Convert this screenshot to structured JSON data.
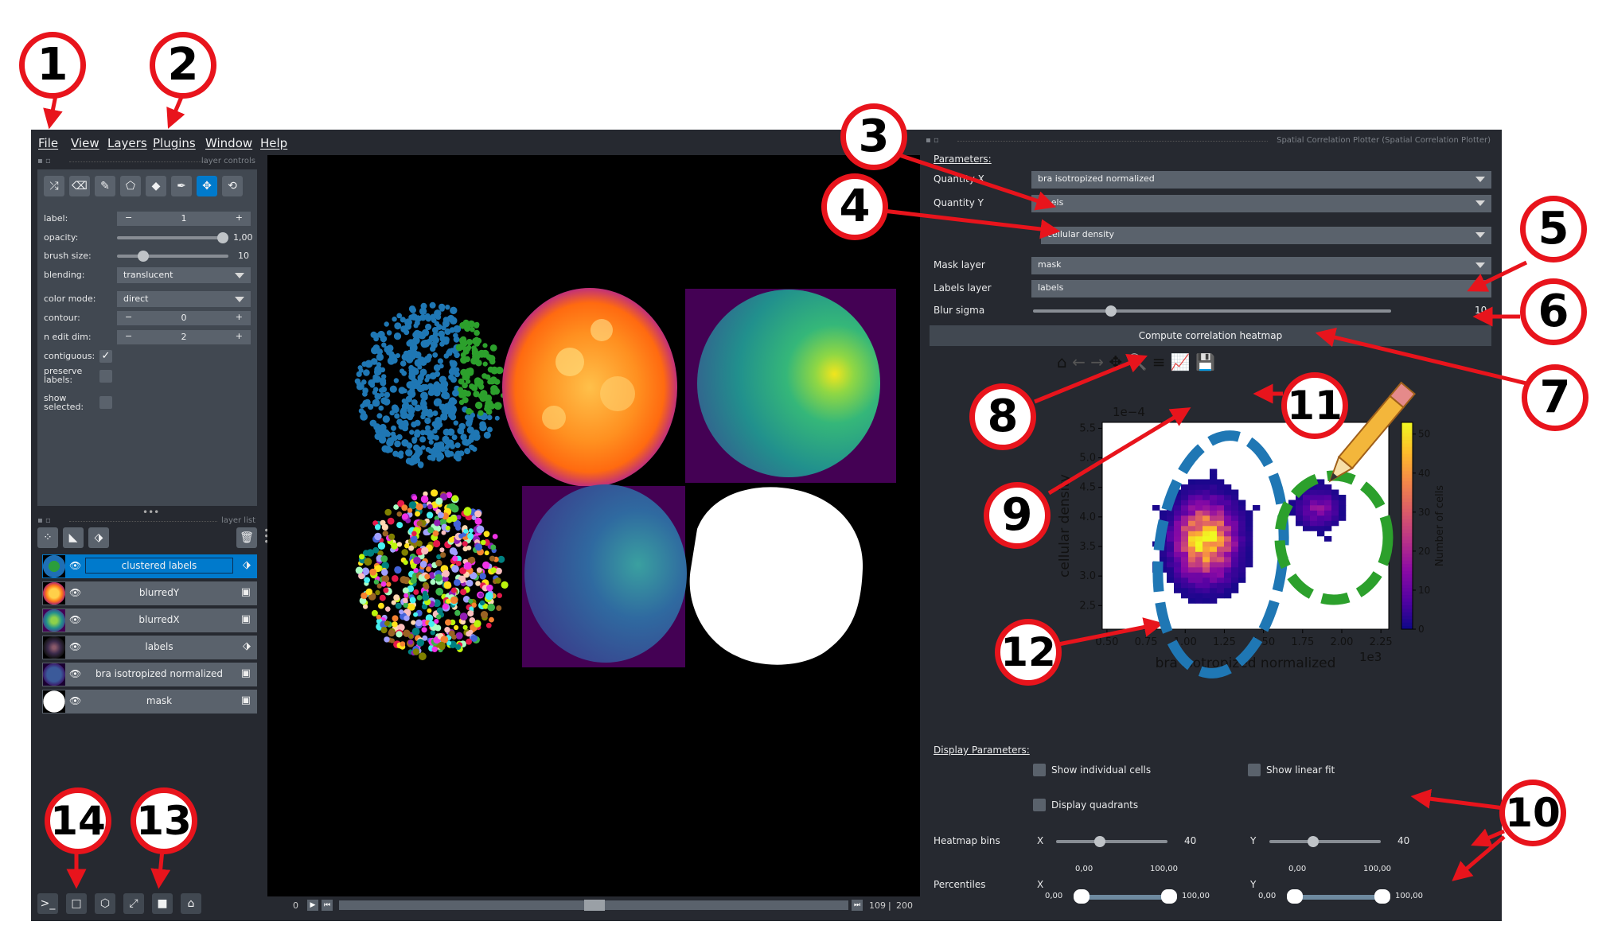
{
  "menu": [
    "File",
    "View",
    "Layers",
    "Plugins",
    "Window",
    "Help"
  ],
  "layer_controls": {
    "dock_title": "layer controls",
    "label": {
      "name": "label:",
      "value": "1"
    },
    "opacity": {
      "name": "opacity:",
      "value": "1,00",
      "level": 1.0
    },
    "brush_size": {
      "name": "brush size:",
      "value": "10",
      "level": 0.1
    },
    "blending": {
      "name": "blending:",
      "value": "translucent"
    },
    "color_mode": {
      "name": "color mode:",
      "value": "direct"
    },
    "contour": {
      "name": "contour:",
      "value": "0"
    },
    "n_edit_dim": {
      "name": "n edit dim:",
      "value": "2"
    },
    "contiguous": {
      "name": "contiguous:",
      "checked": true
    },
    "preserve_labels": {
      "name": "preserve labels:",
      "checked": false
    },
    "show_selected": {
      "name": "show selected:",
      "checked": false
    },
    "tools": [
      "shuffle-icon",
      "eraser-icon",
      "brush-icon",
      "polygon-icon",
      "fill-icon",
      "picker-icon",
      "move-icon",
      "transform-icon"
    ]
  },
  "layer_list": {
    "dock_title": "layer list",
    "layers": [
      {
        "name": "clustered labels",
        "type": "labels",
        "selected": true
      },
      {
        "name": "blurredY",
        "type": "image",
        "selected": false
      },
      {
        "name": "blurredX",
        "type": "image",
        "selected": false
      },
      {
        "name": "labels",
        "type": "labels",
        "selected": false
      },
      {
        "name": "bra isotropized normalized",
        "type": "image",
        "selected": false
      },
      {
        "name": "mask",
        "type": "image",
        "selected": false
      }
    ]
  },
  "dims": {
    "start": "0",
    "current": "109",
    "total": "200"
  },
  "plugin": {
    "dock_title": "Spatial Correlation Plotter (Spatial Correlation Plotter)",
    "parameters_label": "Parameters:",
    "quantity_x_label": "Quantity X",
    "quantity_x_value": "bra isotropized normalized",
    "quantity_y_label": "Quantity Y",
    "quantity_y_value": "labels",
    "quantity_y_feature": "cellular density",
    "mask_layer_label": "Mask layer",
    "mask_layer_value": "mask",
    "labels_layer_label": "Labels layer",
    "labels_layer_value": "labels",
    "blur_sigma_label": "Blur sigma",
    "blur_sigma_value": "10",
    "blur_sigma_level": 0.21,
    "compute_button": "Compute correlation heatmap",
    "display_parameters_label": "Display Parameters:",
    "show_individual_cells": "Show individual cells",
    "show_linear_fit": "Show linear fit",
    "display_quadrants": "Display quadrants",
    "heatmap_bins_label": "Heatmap bins",
    "bins_x_label": "X",
    "bins_x_value": "40",
    "bins_y_label": "Y",
    "bins_y_value": "40",
    "percentiles_label": "Percentiles",
    "perc_x_label": "X",
    "perc_y_label": "Y",
    "perc_min": "0,00",
    "perc_max": "100,00"
  },
  "chart_data": {
    "type": "heatmap",
    "xlabel": "bra isotropized normalized",
    "ylabel": "cellular density",
    "x_multiplier": "1e3",
    "y_multiplier": "1e−4",
    "x_ticks": [
      "0.50",
      "0.75",
      "1.00",
      "1.25",
      "1.50",
      "1.75",
      "2.00",
      "2.25"
    ],
    "y_ticks": [
      "2.5",
      "3.0",
      "3.5",
      "4.0",
      "4.5",
      "5.0",
      "5.5"
    ],
    "xlim": [
      0.47,
      2.3
    ],
    "ylim": [
      2.1,
      5.6
    ],
    "colorbar_label": "Number of cells",
    "colorbar_ticks": [
      "0",
      "10",
      "20",
      "30",
      "40",
      "50"
    ],
    "colorbar_range": [
      0,
      53
    ],
    "clusters": [
      {
        "center_x": 1.13,
        "center_y": 3.6,
        "spread_x": 0.16,
        "spread_y": 0.55,
        "peak": 52,
        "outline_color": "#1f77b4"
      },
      {
        "center_x": 1.85,
        "center_y": 4.15,
        "spread_x": 0.11,
        "spread_y": 0.28,
        "peak": 14,
        "outline_color": "#2ca02c"
      }
    ]
  },
  "callouts": [
    "1",
    "2",
    "3",
    "4",
    "5",
    "6",
    "7",
    "8",
    "9",
    "10",
    "11",
    "12",
    "13",
    "14"
  ]
}
